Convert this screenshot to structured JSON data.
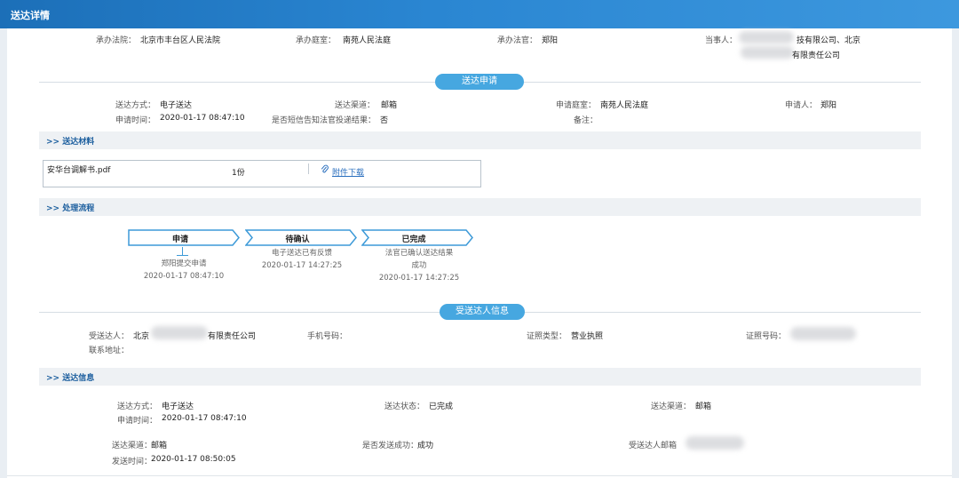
{
  "header": {
    "title": "送达详情"
  },
  "case": {
    "court_label": "承办法院：",
    "court": "北京市丰台区人民法院",
    "tribunal_label": "承办庭室：",
    "tribunal": "南苑人民法庭",
    "judge_label": "承办法官：",
    "judge": "郑阳",
    "party_label": "当事人：",
    "party_line1": "技有限公司、北京",
    "party_line2": "有限责任公司"
  },
  "apply": {
    "pill": "送达申请",
    "method_label": "送达方式：",
    "method": "电子送达",
    "channel_label": "送达渠道：",
    "channel": "邮箱",
    "room_label": "申请庭室：",
    "room": "南苑人民法庭",
    "applicant_label": "申请人：",
    "applicant": "郑阳",
    "time_label": "申请时间：",
    "time": "2020-01-17 08:47:10",
    "sms_label": "是否短信告知法官投递结果：",
    "sms": "否",
    "remark_label": "备注："
  },
  "materials": {
    "title": "送达材料",
    "file_name": "安华台调解书.pdf",
    "count": "1份",
    "download": "附件下载"
  },
  "flow": {
    "title": "处理流程",
    "steps": [
      {
        "label": "申请",
        "desc1": "郑阳提交申请",
        "desc2": "",
        "time": "2020-01-17 08:47:10"
      },
      {
        "label": "待确认",
        "desc1": "电子送达已有反馈",
        "desc2": "",
        "time": "2020-01-17 14:27:25"
      },
      {
        "label": "已完成",
        "desc1": "法官已确认送达结果",
        "desc2": "成功",
        "time": "2020-01-17 14:27:25"
      }
    ]
  },
  "recipient": {
    "pill": "受送达人信息",
    "name_label": "受送达人：",
    "name_a": "北京",
    "name_b": "有限责任公司",
    "phone_label": "手机号码：",
    "id_type_label": "证照类型：",
    "id_type": "营业执照",
    "id_no_label": "证照号码：",
    "address_label": "联系地址："
  },
  "delivery": {
    "title": "送达信息",
    "method_label": "送达方式：",
    "method": "电子送达",
    "status_label": "送达状态：",
    "status": "已完成",
    "channel_label": "送达渠道：",
    "channel": "邮箱",
    "apply_time_label": "申请时间：",
    "apply_time": "2020-01-17 08:47:10",
    "channel2_label": "送达渠道：",
    "channel2": "邮箱",
    "success_label": "是否发送成功：",
    "success": "成功",
    "email_label": "受送达人邮箱",
    "send_time_label": "发送时间：",
    "send_time": "2020-01-17 08:50:05"
  },
  "colors": {
    "header": "#2a86d2",
    "pill": "#46a7e0",
    "step_border": "#3d9ad8",
    "link": "#2a6fbe"
  }
}
